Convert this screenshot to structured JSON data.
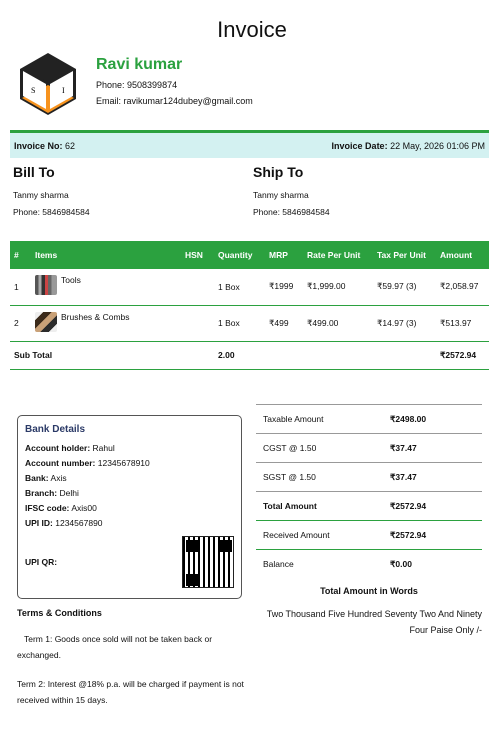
{
  "title": "Invoice",
  "company": {
    "logo_letters": [
      "S",
      "I"
    ],
    "name": "Ravi kumar",
    "phone": "Phone: 9508399874",
    "email": "Email: ravikumar124dubey@gmail.com"
  },
  "invoice": {
    "no_label": "Invoice No:",
    "no_value": "62",
    "date_label": "Invoice Date:",
    "date_value": "22 May, 2026 01:06 PM"
  },
  "bill_to": {
    "heading": "Bill To",
    "name": "Tanmy sharma",
    "phone": "Phone: 5846984584"
  },
  "ship_to": {
    "heading": "Ship To",
    "name": "Tanmy sharma",
    "phone": "Phone: 5846984584"
  },
  "items_table": {
    "headers": [
      "#",
      "Items",
      "HSN",
      "Quantity",
      "MRP",
      "Rate Per Unit",
      "Tax Per Unit",
      "Amount"
    ],
    "rows": [
      {
        "num": "1",
        "item": "Tools",
        "hsn": "",
        "qty": "1 Box",
        "mrp": "₹1999",
        "rate": "₹1,999.00",
        "tax": "₹59.97 (3)",
        "amount": "₹2,058.97"
      },
      {
        "num": "2",
        "item": "Brushes & Combs",
        "hsn": "",
        "qty": "1 Box",
        "mrp": "₹499",
        "rate": "₹499.00",
        "tax": "₹14.97 (3)",
        "amount": "₹513.97"
      }
    ],
    "subtotal": {
      "label": "Sub Total",
      "qty": "2.00",
      "amount": "₹2572.94"
    }
  },
  "bank": {
    "title": "Bank Details",
    "holder_label": "Account holder:",
    "holder": "Rahul",
    "number_label": "Account number:",
    "number": "12345678910",
    "bank_label": "Bank:",
    "bank": "Axis",
    "branch_label": "Branch:",
    "branch": "Delhi",
    "ifsc_label": "IFSC code:",
    "ifsc": "Axis00",
    "upi_label": "UPI ID:",
    "upi": "1234567890",
    "upi_qr_label": "UPI QR:"
  },
  "terms": {
    "title": "Terms & Conditions",
    "term1": "Term 1: Goods once sold will not be taken back or exchanged.",
    "term2": "Term 2: Interest @18% p.a. will be charged if payment is not received within 15 days."
  },
  "totals": {
    "taxable_label": "Taxable Amount",
    "taxable": "₹2498.00",
    "cgst_label": "CGST @ 1.50",
    "cgst": "₹37.47",
    "sgst_label": "SGST @ 1.50",
    "sgst": "₹37.47",
    "total_label": "Total Amount",
    "total": "₹2572.94",
    "received_label": "Received Amount",
    "received": "₹2572.94",
    "balance_label": "Balance",
    "balance": "₹0.00",
    "words_title": "Total Amount in Words",
    "words": "Two Thousand Five Hundred Seventy Two And Ninety Four Paise Only /-"
  },
  "colors": {
    "accent": "#2ba13f",
    "info_bar": "#d3f1f1",
    "logo_orange": "#f7931e",
    "bank_title": "#2b3a67"
  }
}
